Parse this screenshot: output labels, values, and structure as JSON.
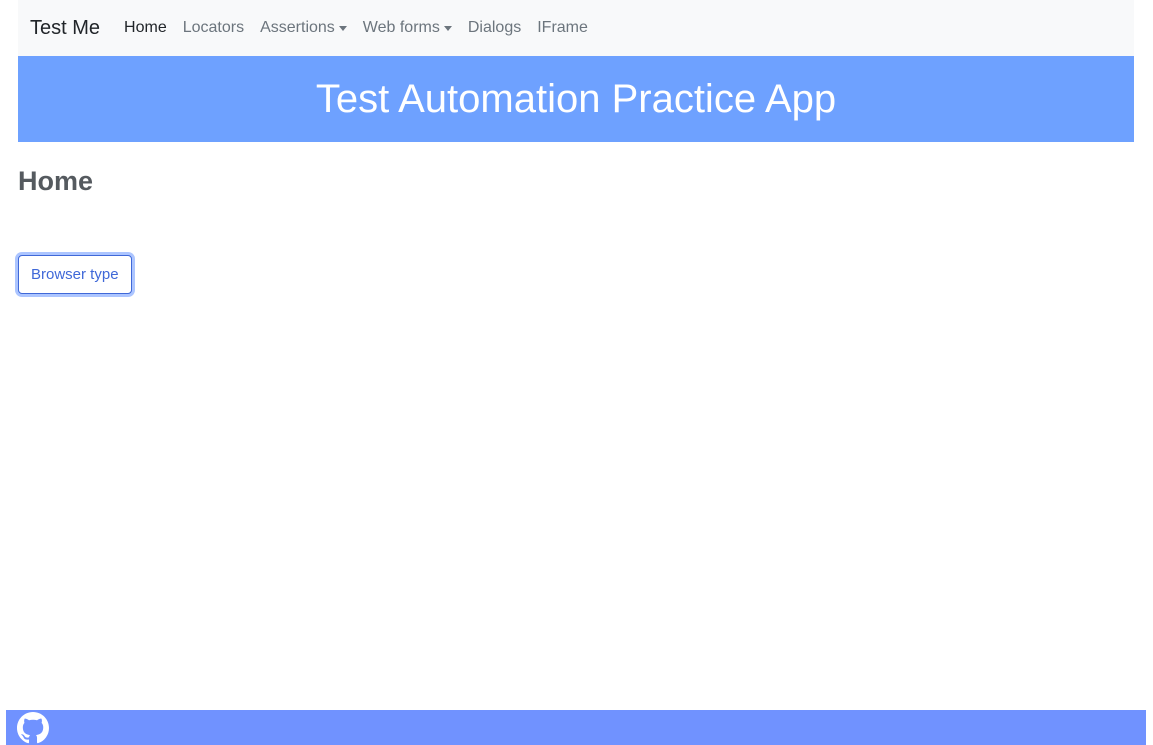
{
  "navbar": {
    "brand": "Test Me",
    "items": [
      {
        "label": "Home"
      },
      {
        "label": "Locators"
      },
      {
        "label": "Assertions"
      },
      {
        "label": "Web forms"
      },
      {
        "label": "Dialogs"
      },
      {
        "label": "IFrame"
      }
    ]
  },
  "banner": {
    "title": "Test Automation Practice App"
  },
  "main": {
    "title": "Home",
    "browser_type_button": "Browser type"
  },
  "footer": {
    "icon": "github-icon"
  },
  "colors": {
    "banner": "#6ea1ff",
    "footer": "#7092ff",
    "button_accent": "#3f68d8",
    "navbar_bg": "#f8f9fa"
  }
}
